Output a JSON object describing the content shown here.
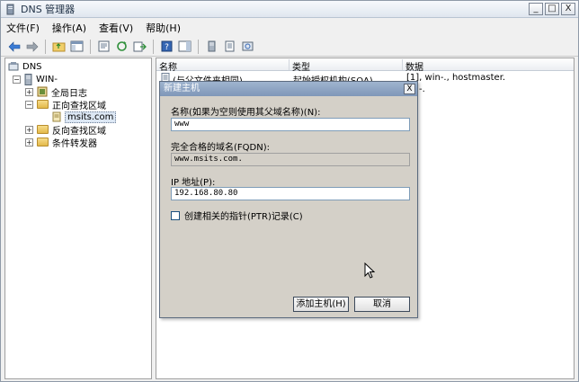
{
  "window": {
    "title": "DNS 管理器",
    "controls": {
      "minimize": "_",
      "maximize": "□",
      "close": "X"
    }
  },
  "menu": [
    {
      "label": "文件(F)"
    },
    {
      "label": "操作(A)"
    },
    {
      "label": "查看(V)"
    },
    {
      "label": "帮助(H)"
    }
  ],
  "tree": {
    "root": "DNS",
    "server": "WIN-",
    "items": [
      {
        "label": "全局日志"
      },
      {
        "label": "正向查找区域"
      },
      {
        "label": "msits.com"
      },
      {
        "label": "反向查找区域"
      },
      {
        "label": "条件转发器"
      }
    ]
  },
  "list": {
    "columns": [
      "名称",
      "类型",
      "数据"
    ],
    "rows": [
      {
        "name": "(与父文件夹相同)",
        "type": "起始授权机构(SOA)",
        "data": "[1], win-., hostmaster."
      },
      {
        "name": "",
        "type": "",
        "data": "-."
      }
    ]
  },
  "dialog": {
    "title": "新建主机",
    "close": "X",
    "name_label": "名称(如果为空则使用其父域名称)(N):",
    "name_value": "www",
    "fqdn_label": "完全合格的域名(FQDN):",
    "fqdn_value": "www.msits.com.",
    "ip_label": "IP 地址(P):",
    "ip_value": "192.168.80.80",
    "ptr_label": "创建相关的指针(PTR)记录(C)",
    "ptr_checked": false,
    "add_button": "添加主机(H)",
    "cancel_button": "取消"
  }
}
